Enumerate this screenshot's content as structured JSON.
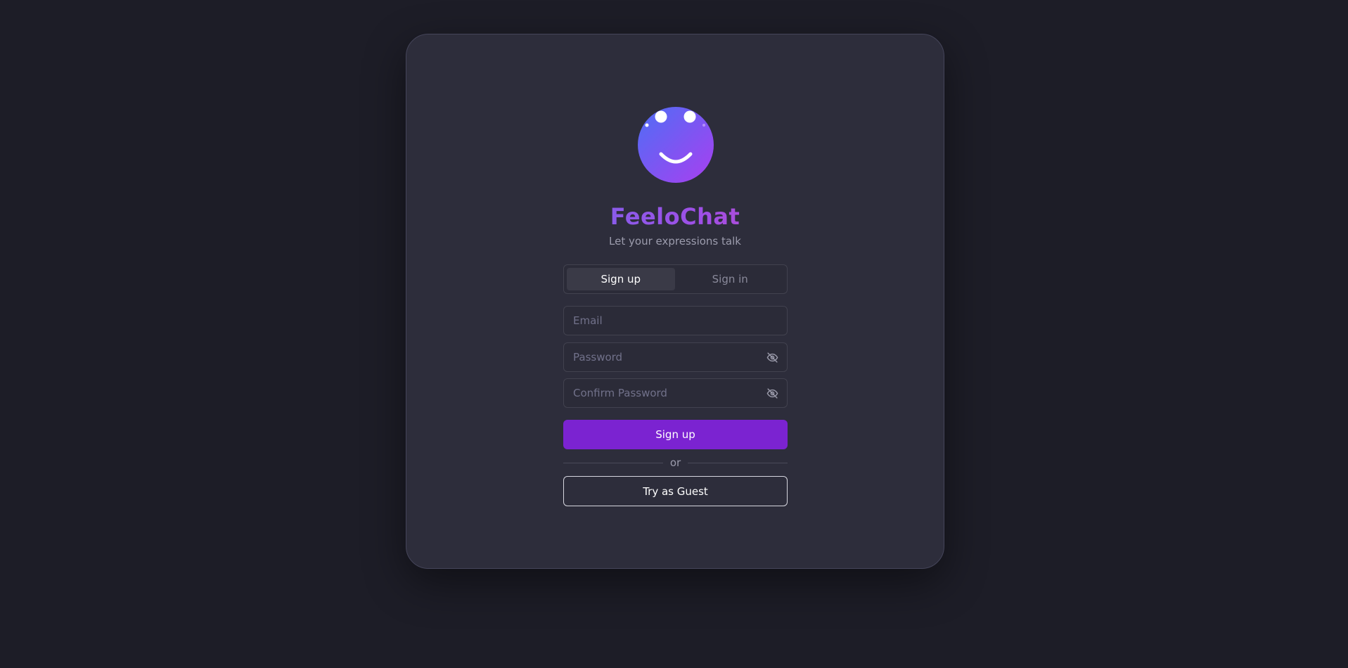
{
  "brand": {
    "name_part1": "Feelo",
    "name_part2": "Chat",
    "tagline": "Let your expressions talk",
    "logo_icon": "smiley-face-icon"
  },
  "tabs": [
    {
      "label": "Sign up",
      "active": true
    },
    {
      "label": "Sign in",
      "active": false
    }
  ],
  "form": {
    "email": {
      "placeholder": "Email",
      "value": ""
    },
    "password": {
      "placeholder": "Password",
      "value": "",
      "icon": "eye-off-icon"
    },
    "confirm_password": {
      "placeholder": "Confirm Password",
      "value": "",
      "icon": "eye-off-icon"
    },
    "submit_label": "Sign up",
    "divider_label": "or",
    "guest_label": "Try as Guest"
  },
  "colors": {
    "background": "#1d1d27",
    "card": "#2d2d3b",
    "accent": "#7b23d1",
    "brand_gradient_start": "#5b76f2",
    "brand_gradient_end": "#e0479e"
  }
}
